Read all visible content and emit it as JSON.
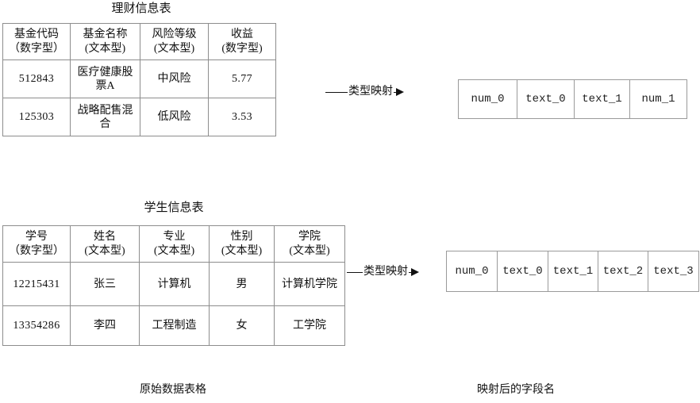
{
  "diagram": {
    "left_caption": "原始数据表格",
    "right_caption": "映射后的字段名"
  },
  "table_fund": {
    "title": "理财信息表",
    "headers": [
      {
        "name": "基金代码",
        "type": "（数字型）"
      },
      {
        "name": "基金名称",
        "type": "(文本型)"
      },
      {
        "name": "风险等级",
        "type": "(文本型)"
      },
      {
        "name": "收益",
        "type": "(数字型)"
      }
    ],
    "rows": [
      {
        "c0": "512843",
        "c1": "医疗健康股票A",
        "c2": "中风险",
        "c3": "5.77"
      },
      {
        "c0": "125303",
        "c1": "战略配售混合",
        "c2": "低风险",
        "c3": "3.53"
      }
    ]
  },
  "table_student": {
    "title": "学生信息表",
    "headers": [
      {
        "name": "学号",
        "type": "（数字型）"
      },
      {
        "name": "姓名",
        "type": "(文本型)"
      },
      {
        "name": "专业",
        "type": "(文本型)"
      },
      {
        "name": "性别",
        "type": "(文本型)"
      },
      {
        "name": "学院",
        "type": "(文本型)"
      }
    ],
    "rows": [
      {
        "c0": "12215431",
        "c1": "张三",
        "c2": "计算机",
        "c3": "男",
        "c4": "计算机学院"
      },
      {
        "c0": "13354286",
        "c1": "李四",
        "c2": "工程制造",
        "c3": "女",
        "c4": "工学院"
      }
    ]
  },
  "arrow_fund": {
    "label": "类型映射"
  },
  "arrow_student": {
    "label": "类型映射"
  },
  "mapped_fund": {
    "fields": [
      "num_0",
      "text_0",
      "text_1",
      "num_1"
    ]
  },
  "mapped_student": {
    "fields": [
      "num_0",
      "text_0",
      "text_1",
      "text_2",
      "text_3"
    ]
  }
}
